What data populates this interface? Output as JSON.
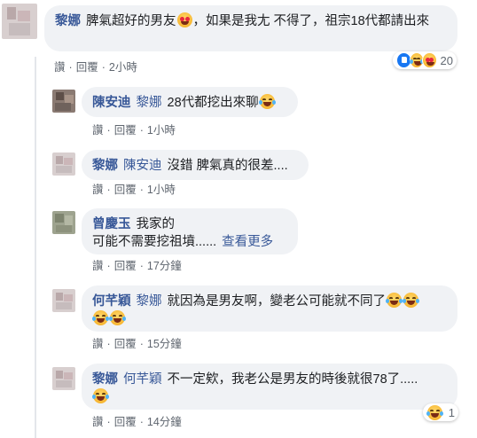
{
  "comments": [
    {
      "author": "黎娜",
      "mention": "",
      "text_pre": "脾氣超好的男友",
      "text_post": "，如果是我尢 不得了，祖宗18代都請出來",
      "actions": {
        "like": "讚",
        "reply": "回覆",
        "time": "2小時"
      },
      "reactions": {
        "count": "20",
        "icons": [
          "like-icon",
          "laugh-icon",
          "heart-eyes-icon"
        ]
      }
    },
    {
      "author": "陳安迪",
      "mention": "黎娜",
      "text": "28代都挖出來聊",
      "actions": {
        "like": "讚",
        "reply": "回覆",
        "time": "1小時"
      }
    },
    {
      "author": "黎娜",
      "mention": "陳安迪",
      "text": "沒錯 脾氣真的很差....",
      "actions": {
        "like": "讚",
        "reply": "回覆",
        "time": "1小時"
      }
    },
    {
      "author": "曾慶玉",
      "mention": "",
      "line1": "我家的",
      "line2": "可能不需要挖祖墳......",
      "see_more": "查看更多",
      "actions": {
        "like": "讚",
        "reply": "回覆",
        "time": "17分鐘"
      }
    },
    {
      "author": "何芊穎",
      "mention": "黎娜",
      "text": "就因為是男友啊，變老公可能就不同了",
      "actions": {
        "like": "讚",
        "reply": "回覆",
        "time": "15分鐘"
      }
    },
    {
      "author": "黎娜",
      "mention": "何芊穎",
      "text": "不一定欸，我老公是男友的時後就很78了.....",
      "actions": {
        "like": "讚",
        "reply": "回覆",
        "time": "14分鐘"
      },
      "reactions": {
        "count": "1",
        "icons": [
          "laugh-icon"
        ]
      }
    }
  ],
  "colors": {
    "name": "#385898",
    "bubble": "#f0f2f5",
    "meta": "#606770",
    "like_blue": "#1877f2"
  }
}
